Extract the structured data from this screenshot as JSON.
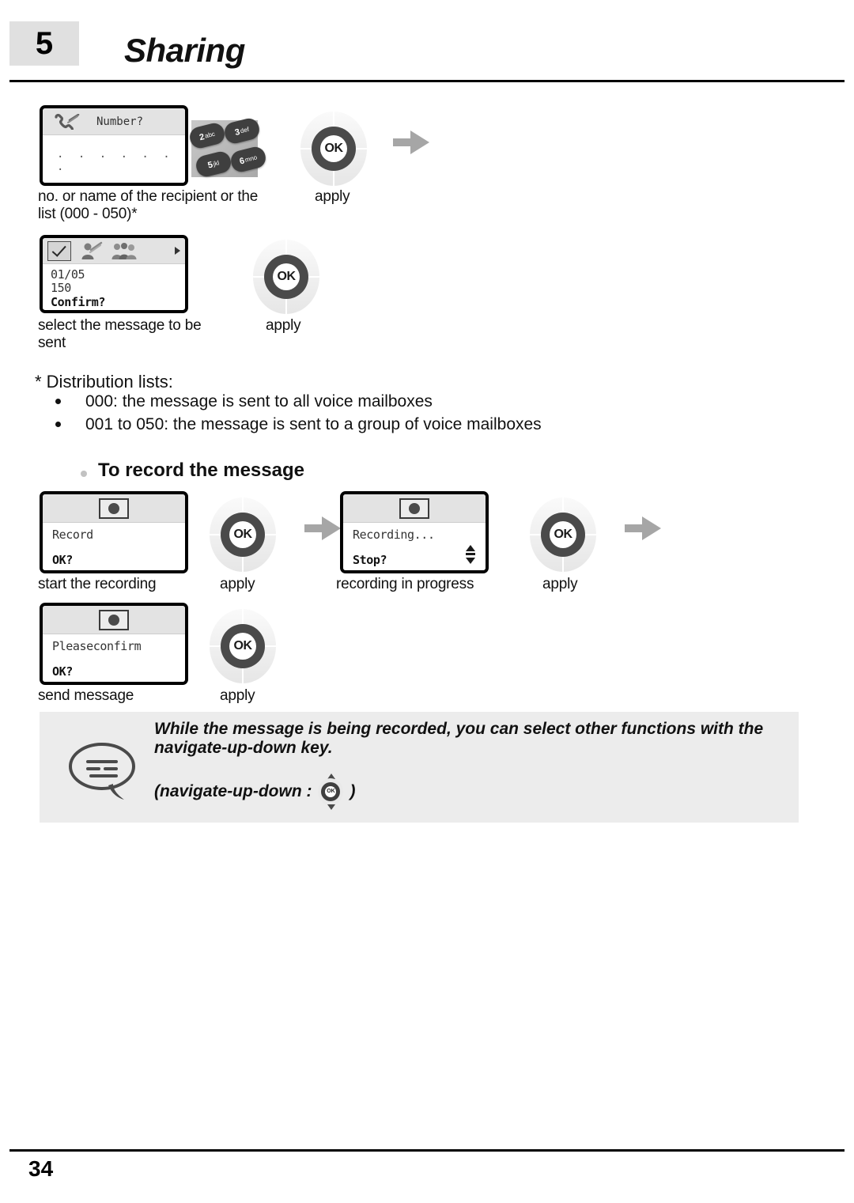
{
  "header": {
    "chapter_number": "5",
    "title": "Sharing"
  },
  "steps": [
    {
      "id": "enter-number",
      "screen": {
        "header_icon": "handset-pen-icon",
        "header_text": "Number?",
        "body_text": ". . . . . . ."
      },
      "keypad_keys": [
        {
          "digit": "2",
          "letters": "abc"
        },
        {
          "digit": "3",
          "letters": "def"
        },
        {
          "digit": "5",
          "letters": "jkl"
        },
        {
          "digit": "6",
          "letters": "mno"
        }
      ],
      "caption": "no. or name of the recipient or the list (000 - 050)*",
      "action_label": "apply"
    },
    {
      "id": "select-message",
      "screen": {
        "icons": [
          "checkbox-checked-icon",
          "person-pen-icon",
          "group-people-icon",
          "caret-right-icon"
        ],
        "line1": "01/05",
        "line2": "150",
        "line3": "Confirm?"
      },
      "caption": "select the message to be sent",
      "action_label": "apply"
    }
  ],
  "distribution": {
    "title": "* Distribution lists:",
    "items": [
      "000: the message is sent to all voice mailboxes",
      "001 to 050: the message is sent to a group of voice mailboxes"
    ]
  },
  "section": {
    "heading": "To record the message"
  },
  "record_steps": [
    {
      "id": "start-recording",
      "screen": {
        "header_icon": "record-icon",
        "line1": "Record",
        "line2": "OK?"
      },
      "caption": "start the recording",
      "action_label": "apply"
    },
    {
      "id": "recording-in-progress",
      "screen": {
        "header_icon": "record-icon",
        "line1": "Recording...",
        "line2": "Stop?",
        "updown_icon": "up-down-arrows-icon"
      },
      "caption": "recording in progress",
      "action_label": "apply"
    },
    {
      "id": "send-message",
      "screen": {
        "header_icon": "record-icon",
        "line1": "Pleaseconfirm",
        "line2": "OK?"
      },
      "caption": "send message",
      "action_label": "apply"
    }
  ],
  "note": {
    "icon": "speech-bubble-icon",
    "text": "While the message is being recorded, you can select other functions with the navigate-up-down key.",
    "label_prefix": "(navigate-up-down :",
    "label_suffix": ")",
    "key_label": "OK"
  },
  "footer": {
    "page_number": "34"
  },
  "colors": {
    "chapter_box": "#e0e0e0",
    "note_bg": "#ececec",
    "arrow": "#a6a6a6",
    "nav_ring": "#4a4a4a"
  },
  "nav_key_label": "OK"
}
